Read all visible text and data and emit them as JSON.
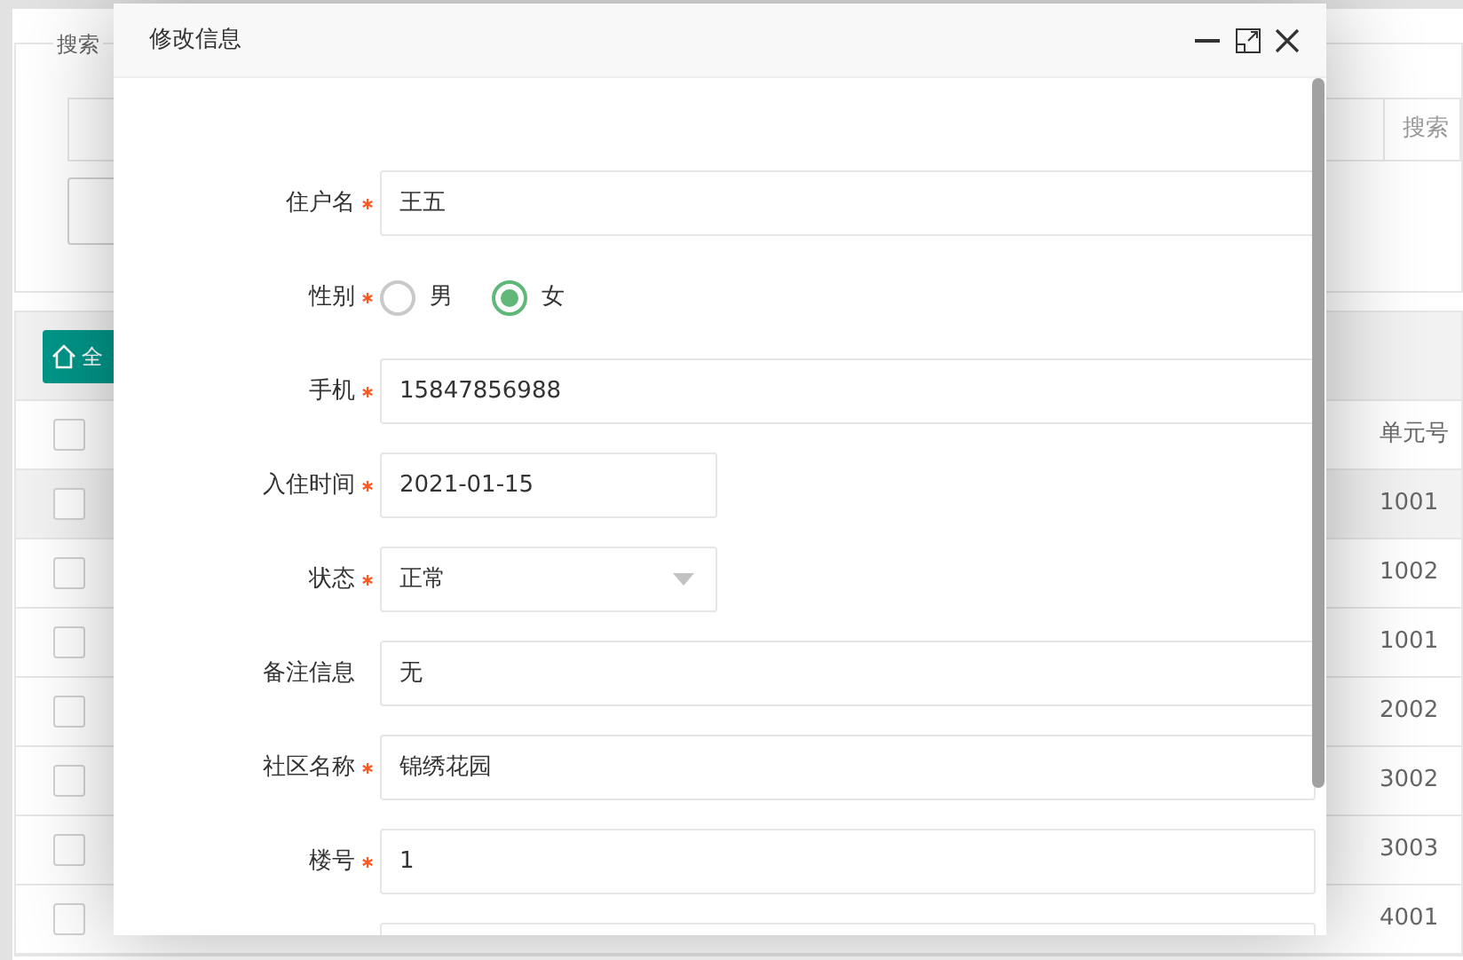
{
  "background": {
    "search_legend": "搜索",
    "search_hint": "搜索",
    "toolbar_button": "全",
    "table": {
      "column": "单元号",
      "header_checked": false,
      "rows": [
        {
          "checked": false,
          "highlighted": true,
          "value": "1001"
        },
        {
          "checked": false,
          "highlighted": false,
          "value": "1002"
        },
        {
          "checked": false,
          "highlighted": false,
          "value": "1001"
        },
        {
          "checked": false,
          "highlighted": false,
          "value": "2002"
        },
        {
          "checked": false,
          "highlighted": false,
          "value": "3002"
        },
        {
          "checked": false,
          "highlighted": false,
          "value": "3003"
        },
        {
          "checked": false,
          "highlighted": false,
          "value": "4001"
        }
      ]
    }
  },
  "dialog": {
    "title": "修改信息",
    "fields": [
      {
        "kind": "text",
        "label": "住户名",
        "required": true,
        "value": "王五"
      },
      {
        "kind": "radio",
        "label": "性别",
        "required": true,
        "options": [
          {
            "label": "男",
            "selected": false
          },
          {
            "label": "女",
            "selected": true
          }
        ]
      },
      {
        "kind": "text",
        "label": "手机",
        "required": true,
        "value": "15847856988"
      },
      {
        "kind": "date",
        "label": "入住时间",
        "required": true,
        "value": "2021-01-15"
      },
      {
        "kind": "select",
        "label": "状态",
        "required": true,
        "value": "正常"
      },
      {
        "kind": "text",
        "label": "备注信息",
        "required": false,
        "value": "无"
      },
      {
        "kind": "text",
        "label": "社区名称",
        "required": true,
        "value": "锦绣花园"
      },
      {
        "kind": "text",
        "label": "楼号",
        "required": true,
        "value": "1"
      },
      {
        "kind": "text"
      }
    ]
  }
}
